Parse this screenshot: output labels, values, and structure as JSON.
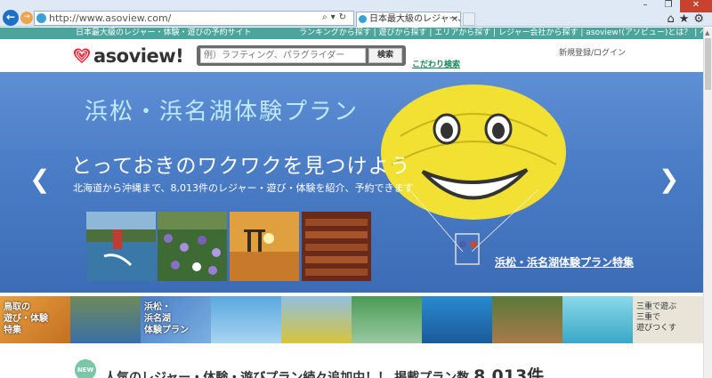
{
  "browser": {
    "url": "http://www.asoview.com/",
    "tab_title": "日本最大級のレジャー、遊び、...",
    "window_controls": [
      "–",
      "❐",
      "✕"
    ]
  },
  "topbar": {
    "tagline": "日本最大級のレジャー・体験・遊びの予約サイト",
    "links": "ランキングから探す | 遊びから探す | エリアから探す | レジャー会社から探す | asoview!(アソビュー)とは？ | ヘルプ"
  },
  "header": {
    "logo_text": "asoview!",
    "search_placeholder": "例）ラフティング、パラグライダー",
    "search_button": "検索",
    "kodawari_link": "こだわり検索",
    "login_link": "新規登録/ログイン"
  },
  "hero": {
    "title": "浜松・浜名湖体験プラン",
    "headline": "とっておきのワクワクを見つけよう",
    "subtext": "北海道から沖縄まで、8,013件のレジャー・遊び・体験を紹介、予約できます",
    "feature_link": "浜松・浜名湖体験プラン特集"
  },
  "strip": {
    "tottori": "鳥取の\n遊び・体験\n特集",
    "hamamatsu": "浜松・\n浜名湖\n体験プラン",
    "mie": "三重で遊ぶ\n三重で\n遊びつくす"
  },
  "news": {
    "badge": "NEW",
    "headline": "人気のレジャー・体験・遊びプラン続々追加中！！ 掲載プラン数",
    "count": "8,013件"
  },
  "colors": {
    "brand_green": "#4aa59c",
    "hero_blue": "#4a7cc6",
    "logo_red": "#e8253a"
  }
}
